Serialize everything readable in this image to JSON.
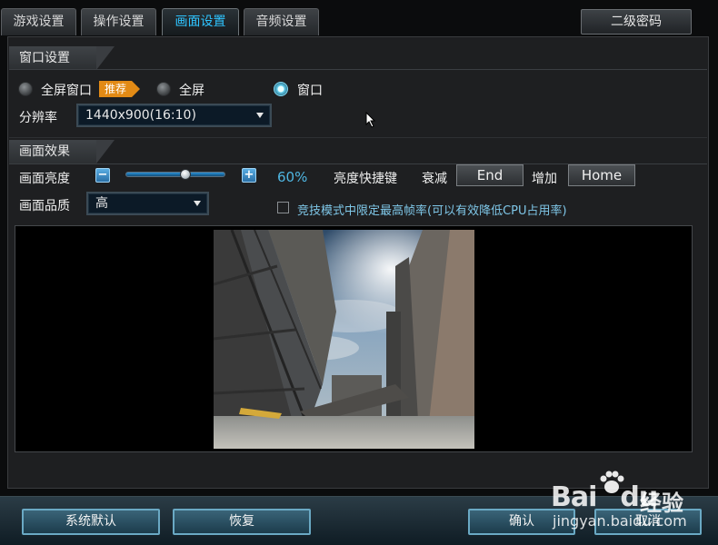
{
  "tabs": [
    {
      "label": "游戏设置",
      "active": false
    },
    {
      "label": "操作设置",
      "active": false
    },
    {
      "label": "画面设置",
      "active": true
    },
    {
      "label": "音频设置",
      "active": false
    }
  ],
  "second_password_button": "二级密码",
  "window_section": {
    "title": "窗口设置",
    "modes": [
      {
        "label": "全屏窗口",
        "selected": false
      },
      {
        "label": "全屏",
        "selected": false
      },
      {
        "label": "窗口",
        "selected": true
      }
    ],
    "recommend_badge": "推荐",
    "resolution_label": "分辨率",
    "resolution_value": "1440x900(16:10)"
  },
  "effects_section": {
    "title": "画面效果",
    "brightness_label": "画面亮度",
    "brightness_value": "60%",
    "brightness_level": 0.6,
    "hotkey_label": "亮度快捷键",
    "decrease_label": "衰减",
    "decrease_key": "End",
    "increase_label": "增加",
    "increase_key": "Home",
    "quality_label": "画面品质",
    "quality_value": "高",
    "fps_limit_label": "竞技模式中限定最高帧率(可以有效降低CPU占用率)",
    "fps_limit_checked": false
  },
  "footer": {
    "default_button": "系统默认",
    "restore_button": "恢复",
    "confirm_button": "确认",
    "cancel_button": "取消"
  },
  "watermark": {
    "logo": "Bai",
    "logo_end": "du",
    "name": "经验",
    "url": "jingyan.baidu.com"
  },
  "colors": {
    "accent": "#2ec4ff",
    "badge": "#e28a15",
    "highlight_text": "#7fc7e8"
  }
}
